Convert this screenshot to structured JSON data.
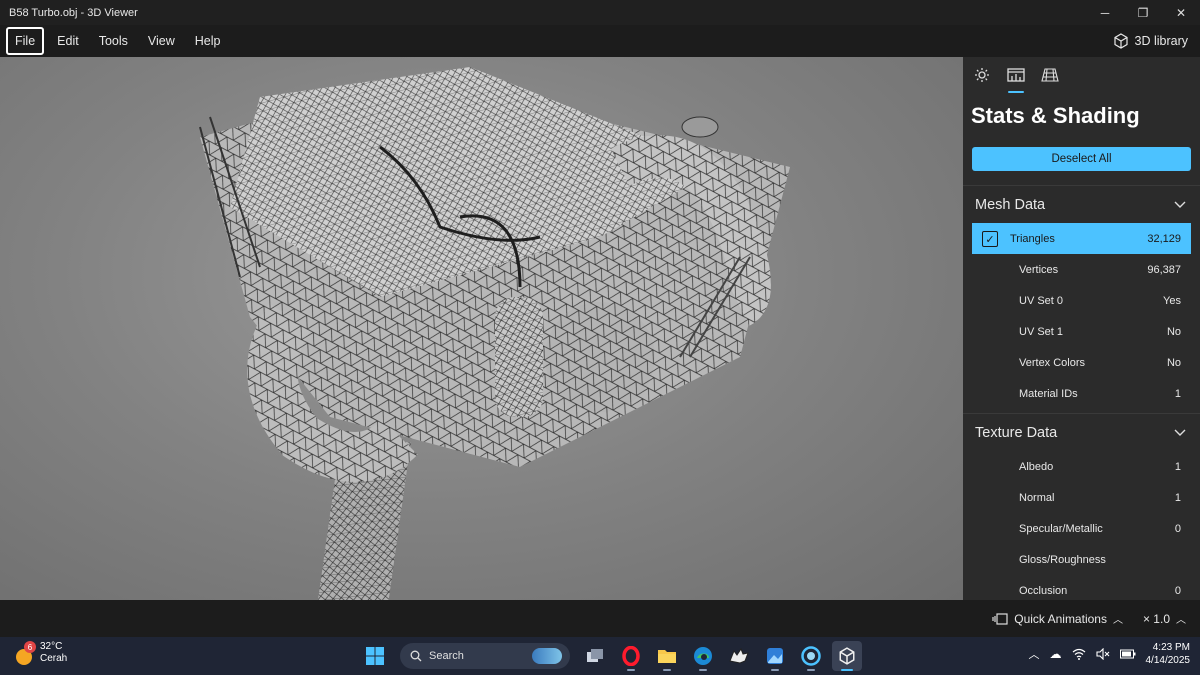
{
  "window": {
    "title": "B58 Turbo.obj - 3D Viewer",
    "minimize": "─",
    "restore": "❐",
    "close": "✕"
  },
  "menu": {
    "items": [
      "File",
      "Edit",
      "Tools",
      "View",
      "Help"
    ],
    "active": "File",
    "library": "3D library"
  },
  "panel": {
    "title": "Stats & Shading",
    "deselect": "Deselect All",
    "mesh": {
      "header": "Mesh Data",
      "rows": [
        {
          "label": "Triangles",
          "value": "32,129",
          "checked": true
        },
        {
          "label": "Vertices",
          "value": "96,387"
        },
        {
          "label": "UV Set 0",
          "value": "Yes"
        },
        {
          "label": "UV Set 1",
          "value": "No"
        },
        {
          "label": "Vertex Colors",
          "value": "No"
        },
        {
          "label": "Material IDs",
          "value": "1"
        }
      ]
    },
    "texture": {
      "header": "Texture Data",
      "rows": [
        {
          "label": "Albedo",
          "value": "1"
        },
        {
          "label": "Normal",
          "value": "1"
        },
        {
          "label": "Specular/Metallic",
          "value": "0"
        },
        {
          "label": "Gloss/Roughness",
          "value": ""
        },
        {
          "label": "Occlusion",
          "value": "0"
        }
      ]
    }
  },
  "status": {
    "quick_animations": "Quick Animations",
    "speed": "× 1.0"
  },
  "taskbar": {
    "weather": {
      "temp": "32°C",
      "condition": "Cerah",
      "badge": "6"
    },
    "search_placeholder": "Search",
    "time": "4:23 PM",
    "date": "4/14/2025"
  },
  "colors": {
    "accent": "#4cc2ff",
    "panel_bg": "#2b2b2b",
    "taskbar_bg": "#1f2535"
  }
}
